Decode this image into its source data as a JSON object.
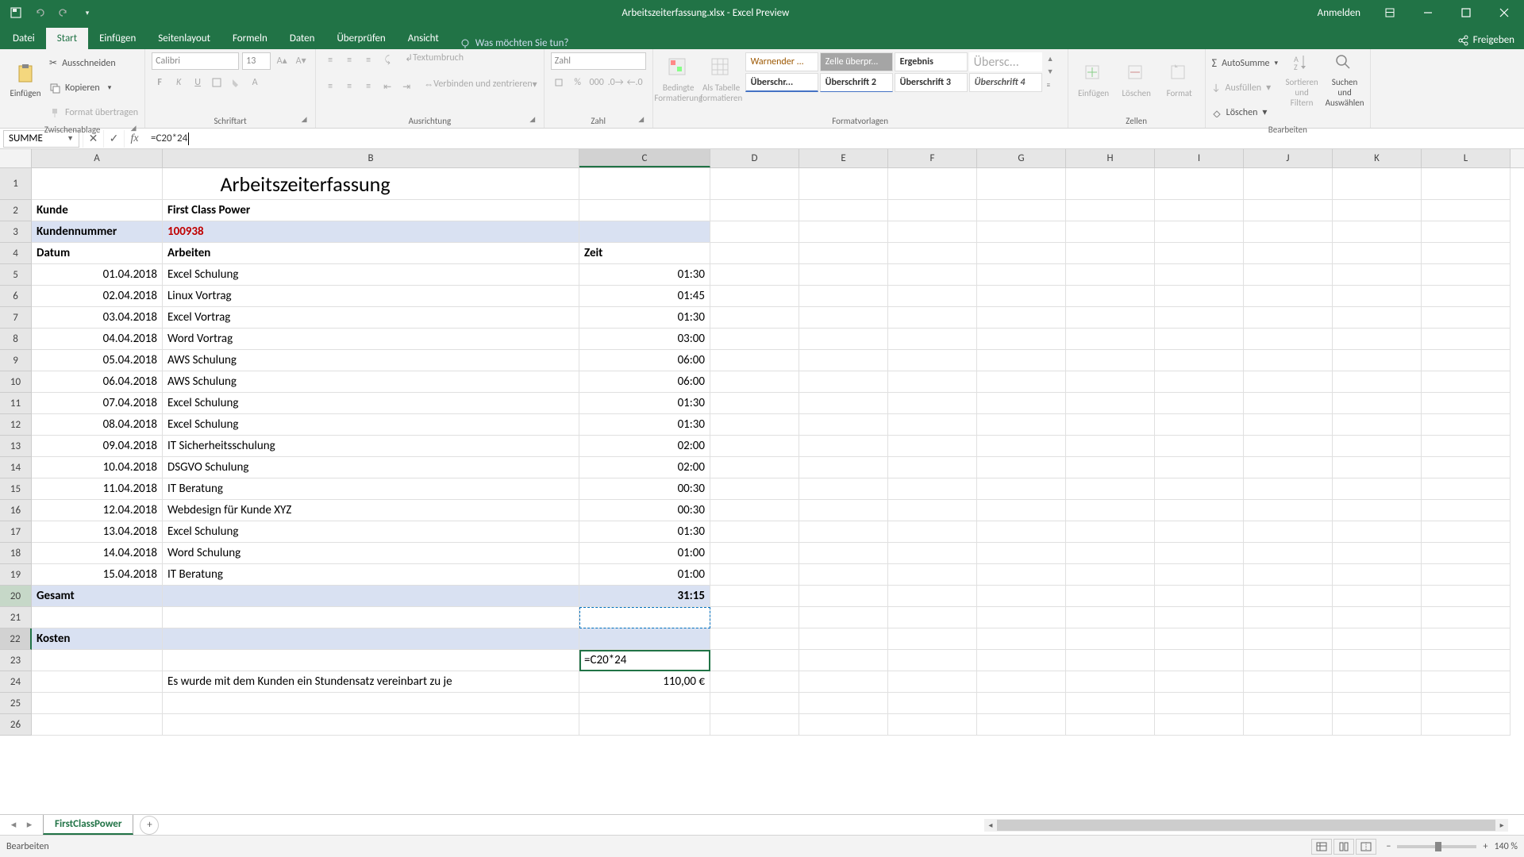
{
  "window": {
    "title": "Arbeitszeiterfassung.xlsx - Excel Preview",
    "anmelden": "Anmelden"
  },
  "tabs": {
    "file": "Datei",
    "start": "Start",
    "einfugen": "Einfügen",
    "seitenlayout": "Seitenlayout",
    "formeln": "Formeln",
    "daten": "Daten",
    "uberprufen": "Überprüfen",
    "ansicht": "Ansicht",
    "tellme": "Was möchten Sie tun?",
    "freigeben": "Freigeben"
  },
  "ribbon": {
    "clipboard": {
      "label": "Zwischenablage",
      "paste": "Einfügen",
      "cut": "Ausschneiden",
      "copy": "Kopieren",
      "format": "Format übertragen"
    },
    "font": {
      "label": "Schriftart",
      "family": "Calibri",
      "size": "13"
    },
    "align": {
      "label": "Ausrichtung",
      "wrap": "Textumbruch",
      "merge": "Verbinden und zentrieren"
    },
    "number": {
      "label": "Zahl",
      "format": "Zahl"
    },
    "styles": {
      "label": "Formatvorlagen",
      "cond": "Bedingte Formatierung",
      "table": "Als Tabelle formatieren",
      "warn": "Warnender ...",
      "check": "Zelle überpr...",
      "result": "Ergebnis",
      "title": "Übersc...",
      "h1": "Überschr...",
      "h2": "Überschrift 2",
      "h3": "Überschrift 3",
      "h4": "Überschrift 4"
    },
    "cells": {
      "label": "Zellen",
      "insert": "Einfügen",
      "delete": "Löschen",
      "format": "Format"
    },
    "edit": {
      "label": "Bearbeiten",
      "sum": "AutoSumme",
      "fill": "Ausfüllen",
      "clear": "Löschen",
      "sort": "Sortieren und Filtern",
      "find": "Suchen und Auswählen"
    }
  },
  "formula_bar": {
    "name_box": "SUMME",
    "formula": "=C20*24"
  },
  "columns": [
    "A",
    "B",
    "C",
    "D",
    "E",
    "F",
    "G",
    "H",
    "I",
    "J",
    "K",
    "L"
  ],
  "sheet": {
    "title_text": "Arbeitszeiterfassung",
    "kunde_label": "Kunde",
    "kunde_value": "First Class Power",
    "kundennr_label": "Kundennummer",
    "kundennr_value": "100938",
    "datum_h": "Datum",
    "arbeiten_h": "Arbeiten",
    "zeit_h": "Zeit",
    "rows": [
      {
        "d": "01.04.2018",
        "a": "Excel Schulung",
        "z": "01:30"
      },
      {
        "d": "02.04.2018",
        "a": "Linux Vortrag",
        "z": "01:45"
      },
      {
        "d": "03.04.2018",
        "a": "Excel Vortrag",
        "z": "01:30"
      },
      {
        "d": "04.04.2018",
        "a": "Word Vortrag",
        "z": "03:00"
      },
      {
        "d": "05.04.2018",
        "a": "AWS Schulung",
        "z": "06:00"
      },
      {
        "d": "06.04.2018",
        "a": "AWS Schulung",
        "z": "06:00"
      },
      {
        "d": "07.04.2018",
        "a": "Excel Schulung",
        "z": "01:30"
      },
      {
        "d": "08.04.2018",
        "a": "Excel Schulung",
        "z": "01:30"
      },
      {
        "d": "09.04.2018",
        "a": "IT Sicherheitsschulung",
        "z": "02:00"
      },
      {
        "d": "10.04.2018",
        "a": "DSGVO Schulung",
        "z": "02:00"
      },
      {
        "d": "11.04.2018",
        "a": "IT Beratung",
        "z": "00:30"
      },
      {
        "d": "12.04.2018",
        "a": "Webdesign für Kunde XYZ",
        "z": "00:30"
      },
      {
        "d": "13.04.2018",
        "a": "Excel Schulung",
        "z": "01:30"
      },
      {
        "d": "14.04.2018",
        "a": "Word Schulung",
        "z": "01:00"
      },
      {
        "d": "15.04.2018",
        "a": "IT Beratung",
        "z": "01:00"
      }
    ],
    "gesamt_label": "Gesamt",
    "gesamt_value": "31:15",
    "kosten_label": "Kosten",
    "kosten_formula": "=C20*24",
    "note": "Es wurde mit dem Kunden ein Stundensatz vereinbart zu je",
    "rate": "110,00 €"
  },
  "sheet_tab": "FirstClassPower",
  "status": {
    "mode": "Bearbeiten",
    "zoom": "140 %"
  }
}
